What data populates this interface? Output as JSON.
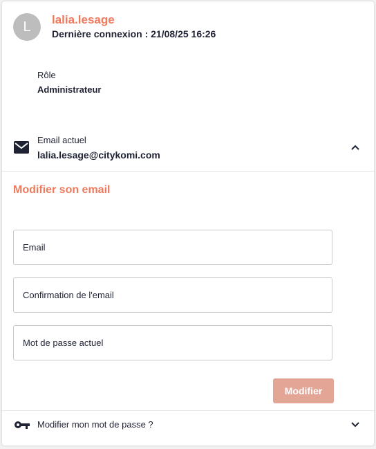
{
  "user": {
    "avatar_initial": "L",
    "username": "lalia.lesage",
    "last_login": "Dernière connexion : 21/08/25 16:26"
  },
  "role": {
    "label": "Rôle",
    "value": "Administrateur"
  },
  "email_section": {
    "label": "Email actuel",
    "value": "lalia.lesage@citykomi.com",
    "icon": "mail-icon",
    "expanded": true
  },
  "edit_email": {
    "title": "Modifier son email",
    "fields": {
      "email": "Email",
      "email_confirm": "Confirmation de l'email",
      "current_password": "Mot de passe actuel"
    },
    "submit_label": "Modifier"
  },
  "password_section": {
    "label": "Modifier mon mot de passe ?",
    "icon": "key-icon",
    "expanded": false
  },
  "colors": {
    "accent": "#ee7a5e",
    "button_disabled": "#e2a596",
    "text": "#1e2233"
  }
}
